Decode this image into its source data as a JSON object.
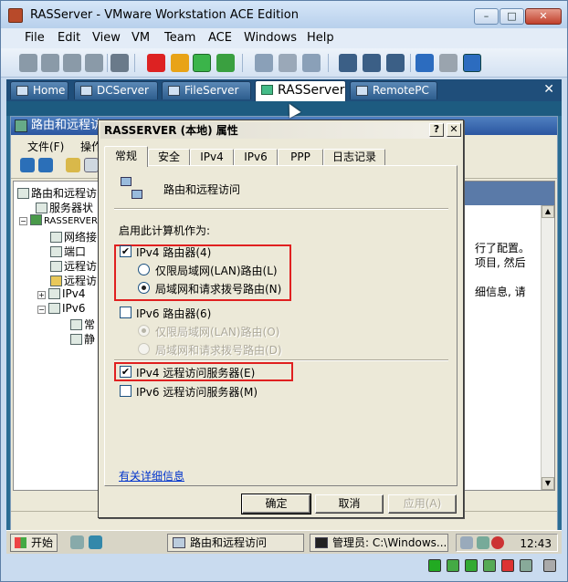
{
  "window": {
    "title": "RASServer - VMware Workstation ACE Edition",
    "min": "–",
    "max": "□",
    "close": "✕"
  },
  "menu": [
    "File",
    "Edit",
    "View",
    "VM",
    "Team",
    "ACE",
    "Windows",
    "Help"
  ],
  "vm_tabs": [
    {
      "label": "Home",
      "active": false
    },
    {
      "label": "DCServer",
      "active": false
    },
    {
      "label": "FileServer",
      "active": false
    },
    {
      "label": "RASServer",
      "active": true
    },
    {
      "label": "RemotePC",
      "active": false
    }
  ],
  "vm_tabs_close": "✕",
  "mmc": {
    "title": "路由和远程访",
    "menu": [
      "文件(F)",
      "操作"
    ],
    "tree": [
      "路由和远程访",
      "服务器状",
      "RASSERVER",
      "网络接",
      "端口",
      "远程访",
      "远程访",
      "IPv4",
      "IPv6",
      "常",
      "静"
    ],
    "tree_expanders": [
      "−",
      "+",
      "−"
    ],
    "right_text": [
      "行了配置。",
      "项目, 然后",
      "细信息, 请"
    ],
    "scroll_up": "▲",
    "scroll_down": "▼"
  },
  "taskbar": {
    "start": "开始",
    "items": [
      "路由和远程访问",
      "管理员: C:\\Windows..."
    ],
    "clock": "12:43"
  },
  "dialog": {
    "title": "RASSERVER (本地) 属性",
    "help": "?",
    "close": "✕",
    "tabs": [
      "常规",
      "安全",
      "IPv4",
      "IPv6",
      "PPP",
      "日志记录"
    ],
    "server_name": "路由和远程访问",
    "enable_label": "启用此计算机作为:",
    "ipv4_router": {
      "label": "IPv4 路由器(4)",
      "checked": true
    },
    "ipv4_lan_only": {
      "label": "仅限局域网(LAN)路由(L)",
      "selected": false
    },
    "ipv4_lan_demand": {
      "label": "局域网和请求拨号路由(N)",
      "selected": true
    },
    "ipv6_router": {
      "label": "IPv6 路由器(6)",
      "checked": false
    },
    "ipv6_lan_only": {
      "label": "仅限局域网(LAN)路由(O)",
      "selected": true
    },
    "ipv6_lan_demand": {
      "label": "局域网和请求拨号路由(D)",
      "selected": false
    },
    "ipv4_ras": {
      "label": "IPv4 远程访问服务器(E)",
      "checked": true
    },
    "ipv6_ras": {
      "label": "IPv6 远程访问服务器(M)",
      "checked": false
    },
    "more_info": "有关详细信息",
    "ok": "确定",
    "cancel": "取消",
    "apply": "应用(A)"
  }
}
